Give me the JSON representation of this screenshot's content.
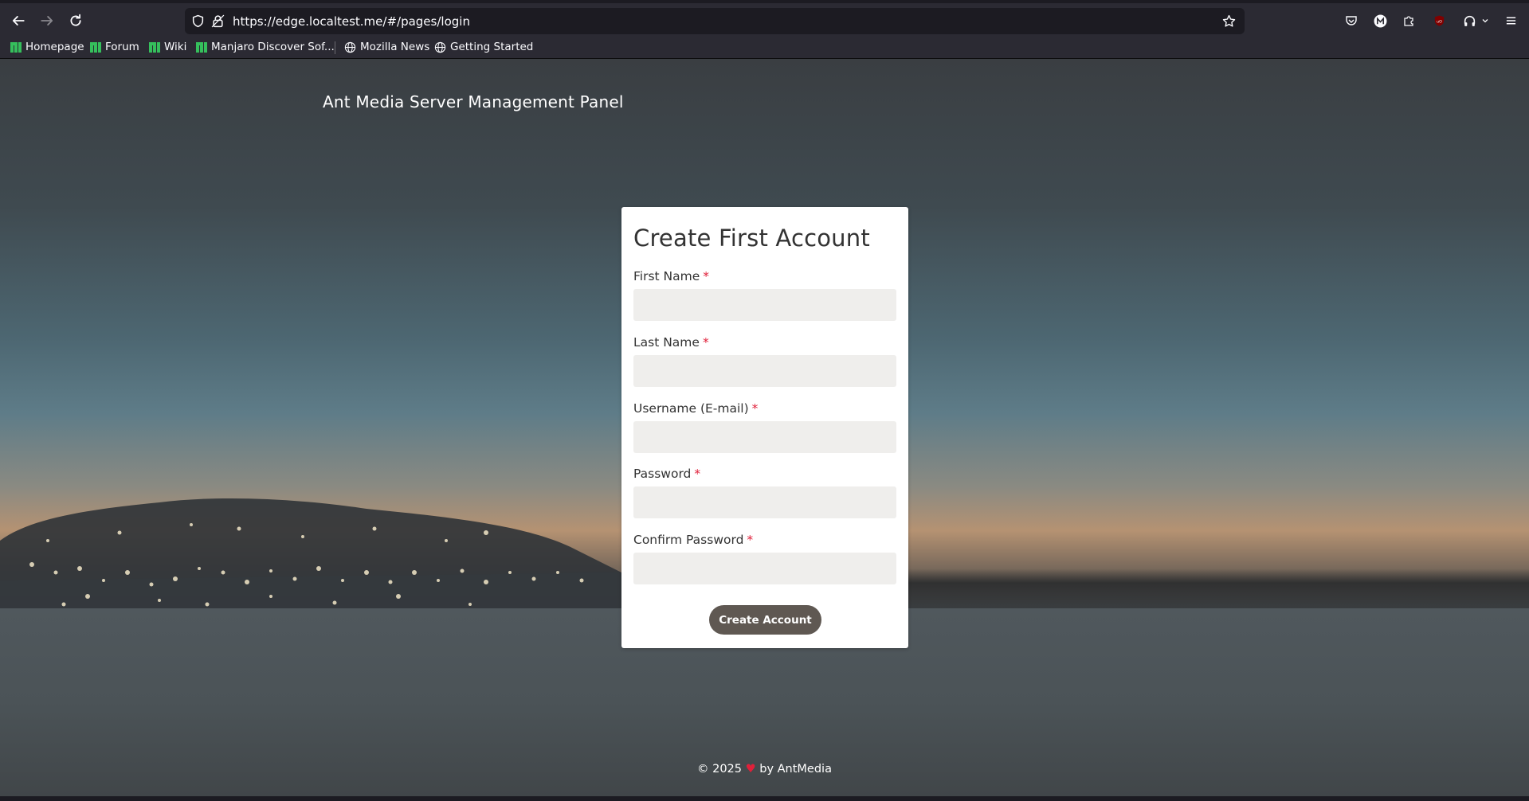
{
  "browser": {
    "url": "https://edge.localtest.me/#/pages/login",
    "bookmarks": [
      {
        "label": "Homepage",
        "icon": "manjaro-icon"
      },
      {
        "label": "Forum",
        "icon": "manjaro-icon"
      },
      {
        "label": "Wiki",
        "icon": "manjaro-icon"
      },
      {
        "label": "Manjaro Discover Sof...",
        "icon": "manjaro-icon"
      },
      {
        "label": "Mozilla News",
        "icon": "globe-icon"
      },
      {
        "label": "Getting Started",
        "icon": "globe-icon"
      }
    ]
  },
  "header": {
    "title": "Ant Media Server Management Panel"
  },
  "form": {
    "title": "Create First Account",
    "required_mark": "*",
    "fields": [
      {
        "label": "First Name",
        "value": "",
        "placeholder": ""
      },
      {
        "label": "Last Name",
        "value": "",
        "placeholder": ""
      },
      {
        "label": "Username (E-mail)",
        "value": "",
        "placeholder": ""
      },
      {
        "label": "Password",
        "value": "",
        "placeholder": ""
      },
      {
        "label": "Confirm Password",
        "value": "",
        "placeholder": ""
      }
    ],
    "submit_label": "Create Account"
  },
  "footer": {
    "prefix": "© 2025",
    "heart": "♥",
    "suffix": "by AntMedia"
  },
  "colors": {
    "accent_button": "#5f5852",
    "required": "#e0203a",
    "input_bg": "#efeeec"
  }
}
